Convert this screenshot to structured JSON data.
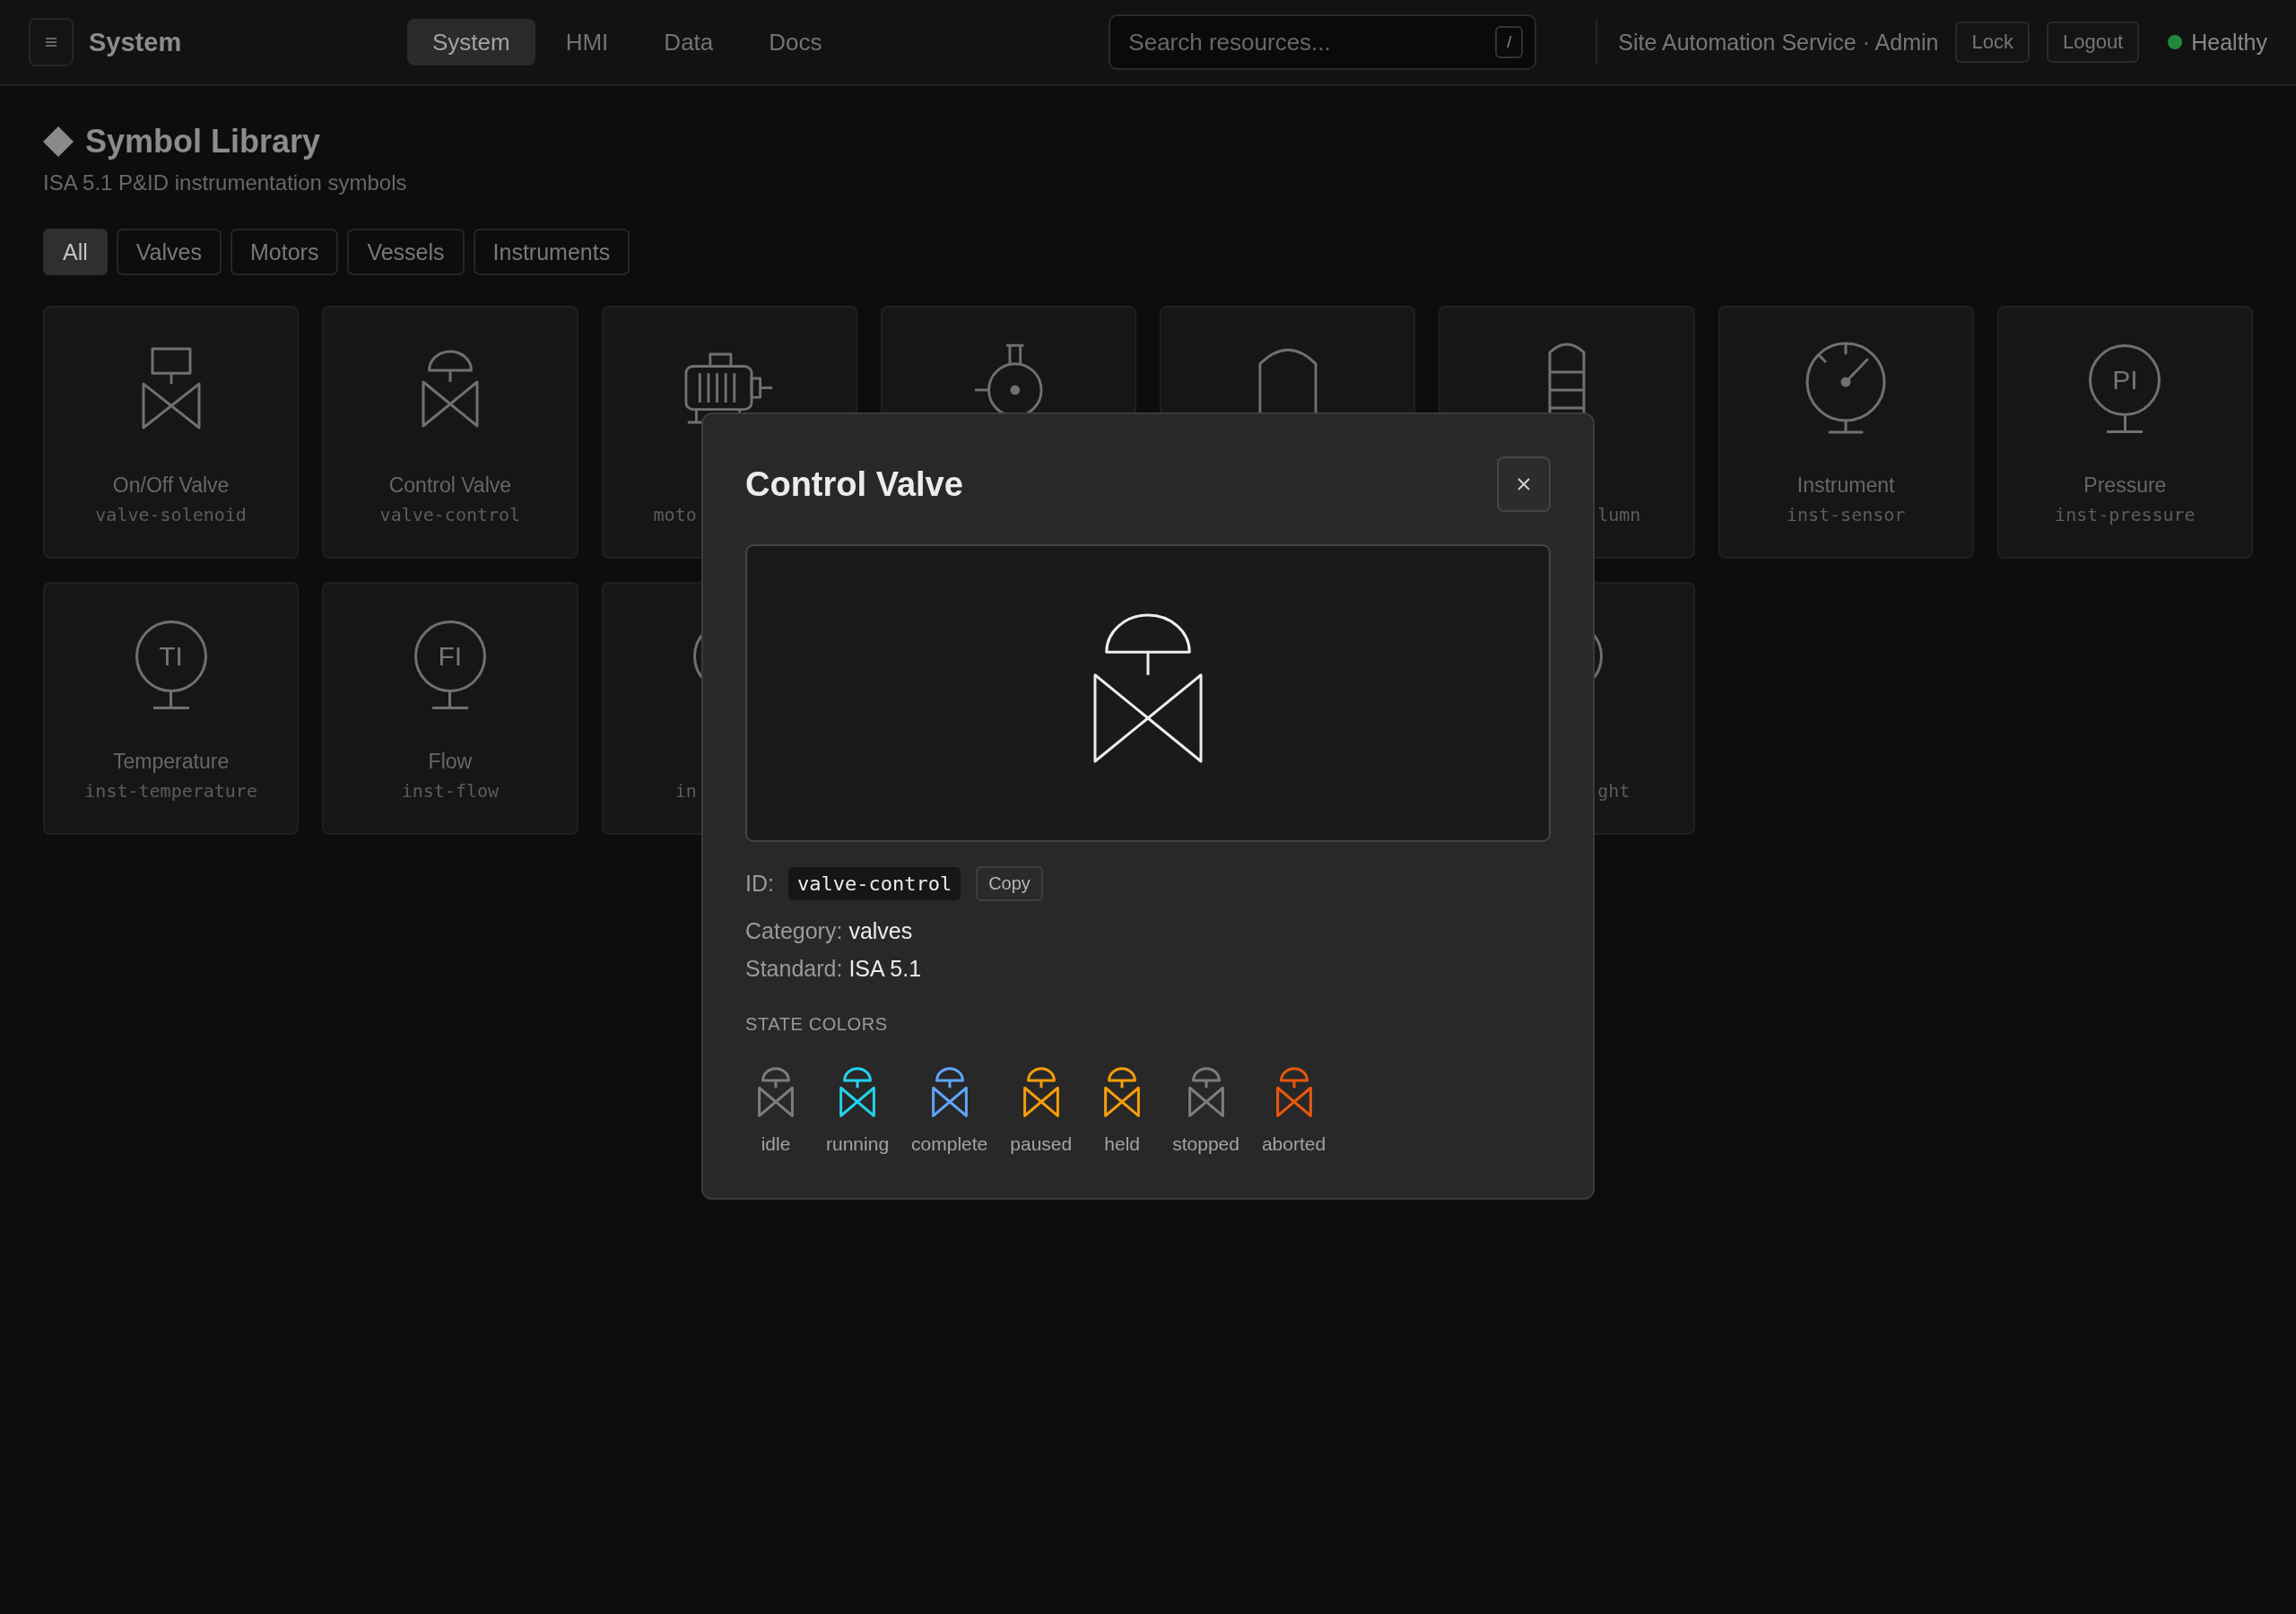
{
  "app": {
    "title": "System"
  },
  "nav": [
    {
      "label": "System",
      "selected": true
    },
    {
      "label": "HMI",
      "selected": false
    },
    {
      "label": "Data",
      "selected": false
    },
    {
      "label": "Docs",
      "selected": false
    }
  ],
  "search": {
    "placeholder": "Search resources...",
    "shortcut": "/"
  },
  "session": {
    "user": "Site Automation Service · Admin",
    "buttons": [
      "Lock",
      "Logout"
    ],
    "status": {
      "label": "Healthy",
      "healthy": true
    }
  },
  "page": {
    "title": "Symbol Library",
    "subtitle": "ISA 5.1 P&ID instrumentation symbols"
  },
  "filters": [
    {
      "label": "All",
      "selected": true
    },
    {
      "label": "Valves",
      "selected": false
    },
    {
      "label": "Motors",
      "selected": false
    },
    {
      "label": "Vessels",
      "selected": false
    },
    {
      "label": "Instruments",
      "selected": false
    }
  ],
  "cards": [
    {
      "kind": "solenoid_valve",
      "label": "On/Off Valve",
      "symbol_id": "valve-solenoid"
    },
    {
      "kind": "control_valve",
      "label": "Control Valve",
      "symbol_id": "valve-control"
    },
    {
      "kind": "motor",
      "symbol_id": "moto"
    },
    {
      "kind": "pump"
    },
    {
      "kind": "vessel"
    },
    {
      "kind": "column",
      "symbol_id": "lumn"
    },
    {
      "kind": "gauge",
      "label": "Instrument",
      "symbol_id": "inst-sensor"
    },
    {
      "kind": "instrument",
      "tag": "PI",
      "label": "Pressure",
      "symbol_id": "inst-pressure"
    },
    {
      "kind": "instrument",
      "tag": "TI",
      "label": "Temperature",
      "symbol_id": "inst-temperature"
    },
    {
      "kind": "instrument",
      "tag": "FI",
      "label": "Flow",
      "symbol_id": "inst-flow"
    },
    {
      "kind": "instrument",
      "symbol_id": "in"
    },
    {
      "kind": "instrument",
      "symbol_id": "ght"
    }
  ],
  "dialog": {
    "title": "Control Valve",
    "kind": "control_valve",
    "id_label": "ID:",
    "symbol_id": "valve-control",
    "copy_button": "Copy",
    "fields": [
      {
        "label": "Category:",
        "value": "valves"
      },
      {
        "label": "Standard:",
        "value": "ISA 5.1"
      }
    ],
    "states_heading": "STATE COLORS",
    "states": [
      {
        "label": "idle",
        "color": "#7d7d7d"
      },
      {
        "label": "running",
        "color": "#22d3ee"
      },
      {
        "label": "complete",
        "color": "#60a5fa"
      },
      {
        "label": "paused",
        "color": "#f59e0b"
      },
      {
        "label": "held",
        "color": "#f59e0b"
      },
      {
        "label": "stopped",
        "color": "#7d7d7d"
      },
      {
        "label": "aborted",
        "color": "#ea580c"
      }
    ]
  }
}
